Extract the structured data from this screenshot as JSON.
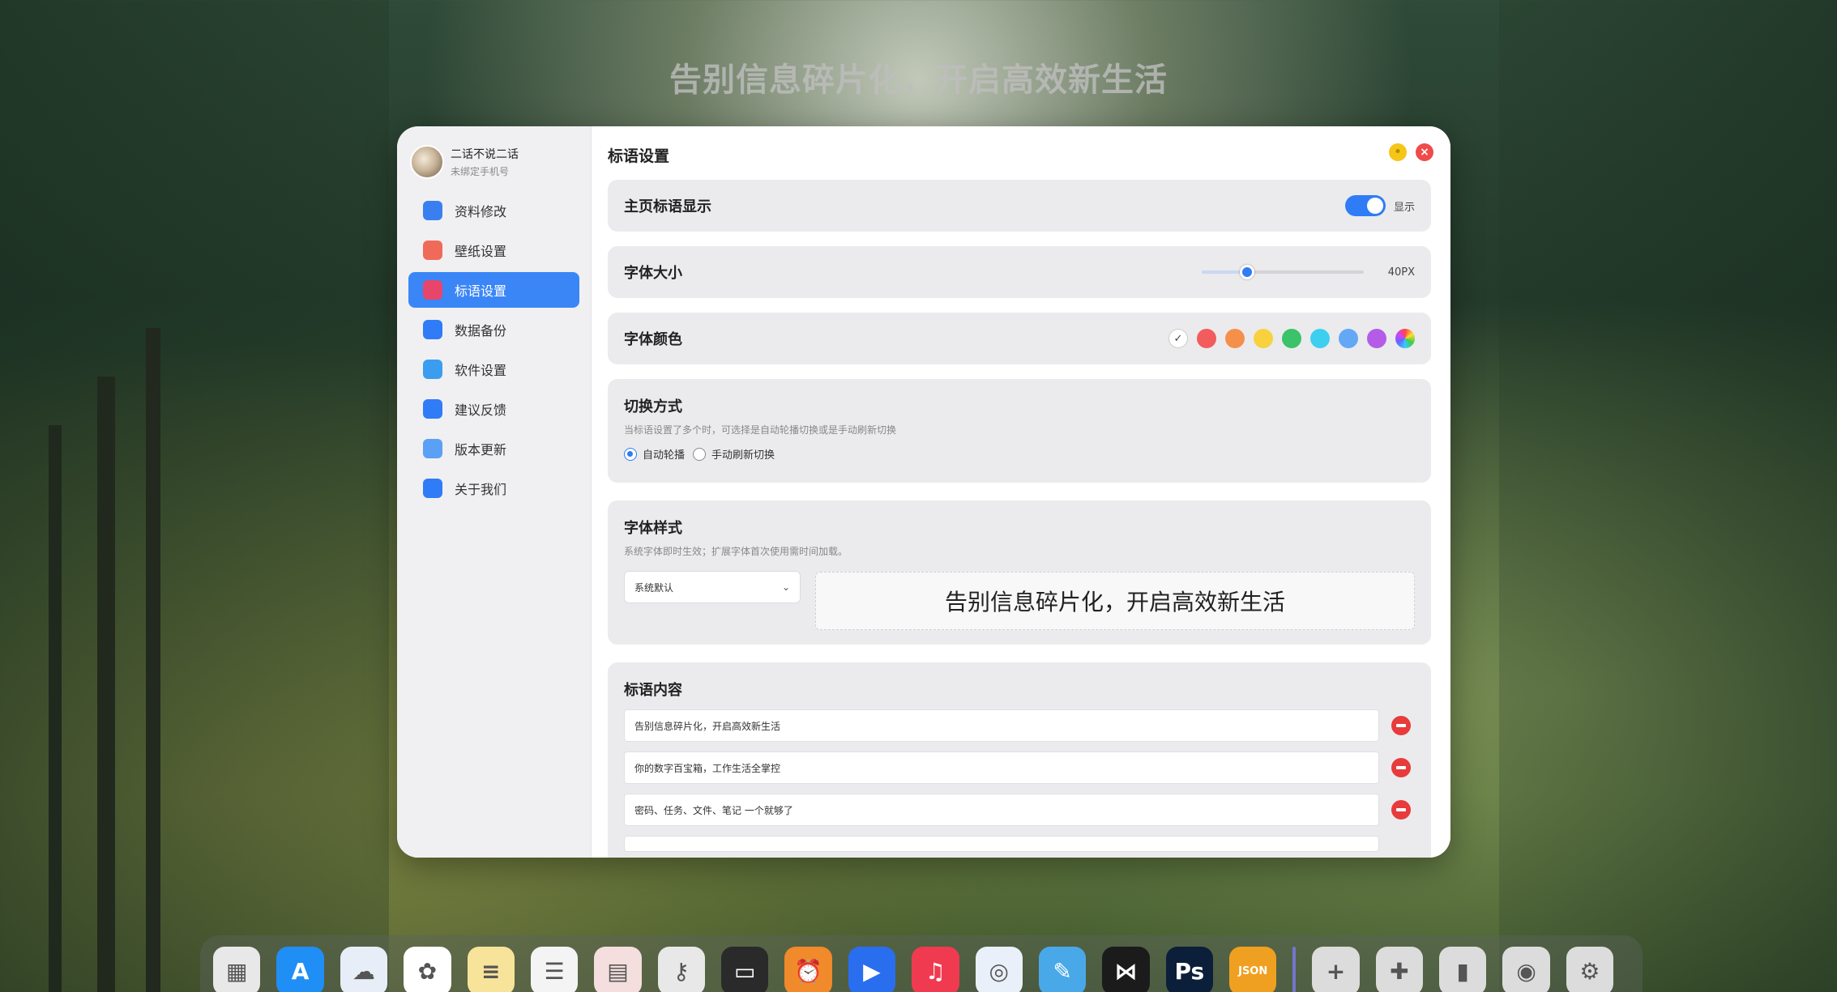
{
  "desktop": {
    "headline": "告别信息碎片化，开启高效新生活"
  },
  "profile": {
    "name": "二话不说二话",
    "phone_status": "未绑定手机号"
  },
  "sidebar": {
    "items": [
      {
        "label": "资料修改",
        "icon": "user-card-icon",
        "color": "#3a7ff0"
      },
      {
        "label": "壁纸设置",
        "icon": "wallpaper-icon",
        "color": "#f06a5a"
      },
      {
        "label": "标语设置",
        "icon": "quote-icon",
        "color": "#e8456b",
        "active": true
      },
      {
        "label": "数据备份",
        "icon": "cloud-icon",
        "color": "#2f7cf6"
      },
      {
        "label": "软件设置",
        "icon": "monitor-icon",
        "color": "#3a9df0"
      },
      {
        "label": "建议反馈",
        "icon": "feedback-icon",
        "color": "#2f7cf6"
      },
      {
        "label": "版本更新",
        "icon": "update-icon",
        "color": "#5aa0f5"
      },
      {
        "label": "关于我们",
        "icon": "info-icon",
        "color": "#2f7cf6"
      }
    ]
  },
  "main": {
    "title": "标语设置",
    "show_slogan": {
      "label": "主页标语显示",
      "state_label": "显示",
      "enabled": true
    },
    "font_size": {
      "label": "字体大小",
      "value_label": "40PX",
      "fraction": 0.28
    },
    "font_color": {
      "label": "字体颜色",
      "swatches": [
        "#ffffff",
        "#f25c5c",
        "#f5904a",
        "#f7d23e",
        "#3cc26a",
        "#3ccff0",
        "#62a8f5",
        "#b45ce8",
        "rainbow"
      ],
      "selected_index": 0
    },
    "switch_mode": {
      "label": "切换方式",
      "description": "当标语设置了多个时，可选择是自动轮播切换或是手动刷新切换",
      "options": [
        "自动轮播",
        "手动刷新切换"
      ],
      "selected_index": 0
    },
    "font_style": {
      "label": "字体样式",
      "description": "系统字体即时生效；扩展字体首次使用需时间加载。",
      "selected_font": "系统默认",
      "preview_text": "告别信息碎片化，开启高效新生活"
    },
    "slogans": {
      "label": "标语内容",
      "items": [
        "告别信息碎片化，开启高效新生活",
        "你的数字百宝箱，工作生活全掌控",
        "密码、任务、文件、笔记 一个就够了"
      ]
    }
  },
  "dock": {
    "icons": [
      {
        "name": "launchpad-icon",
        "color": "#e8e8e8",
        "glyph": "▦"
      },
      {
        "name": "app-store-icon",
        "color": "#1f8ef5",
        "glyph": "A"
      },
      {
        "name": "icloud-icon",
        "color": "#e8eef8",
        "glyph": "☁"
      },
      {
        "name": "photos-icon",
        "color": "#ffffff",
        "glyph": "✿"
      },
      {
        "name": "notes-icon",
        "color": "#f7e39a",
        "glyph": "≡"
      },
      {
        "name": "reminders-icon",
        "color": "#f4f4f4",
        "glyph": "☰"
      },
      {
        "name": "calendar-icon",
        "color": "#f4dede",
        "glyph": "▤"
      },
      {
        "name": "passwords-icon",
        "color": "#e8e8e8",
        "glyph": "⚷"
      },
      {
        "name": "wallet-icon",
        "color": "#2a2a2a",
        "glyph": "▭"
      },
      {
        "name": "clock-icon",
        "color": "#f08a2a",
        "glyph": "⏰"
      },
      {
        "name": "play-icon",
        "color": "#2a6ef0",
        "glyph": "▶"
      },
      {
        "name": "music-icon",
        "color": "#f03a50",
        "glyph": "♫"
      },
      {
        "name": "safari-icon",
        "color": "#e9f0fa",
        "glyph": "◎"
      },
      {
        "name": "freeform-icon",
        "color": "#49a9e8",
        "glyph": "✎"
      },
      {
        "name": "compare-icon",
        "color": "#1b1b1b",
        "glyph": "⋈"
      },
      {
        "name": "photoshop-icon",
        "color": "#0b1f3a",
        "glyph": "Ps"
      },
      {
        "name": "json-icon",
        "color": "#f0a020",
        "glyph": "JSON"
      },
      {
        "name": "add-icon",
        "color": "#dcdcdc",
        "glyph": "+"
      },
      {
        "name": "extensions-icon",
        "color": "#dcdcdc",
        "glyph": "✚"
      },
      {
        "name": "brush-icon",
        "color": "#dcdcdc",
        "glyph": "▮"
      },
      {
        "name": "screen-capture-icon",
        "color": "#dcdcdc",
        "glyph": "◉"
      },
      {
        "name": "system-settings-icon",
        "color": "#dcdcdc",
        "glyph": "⚙"
      }
    ]
  }
}
